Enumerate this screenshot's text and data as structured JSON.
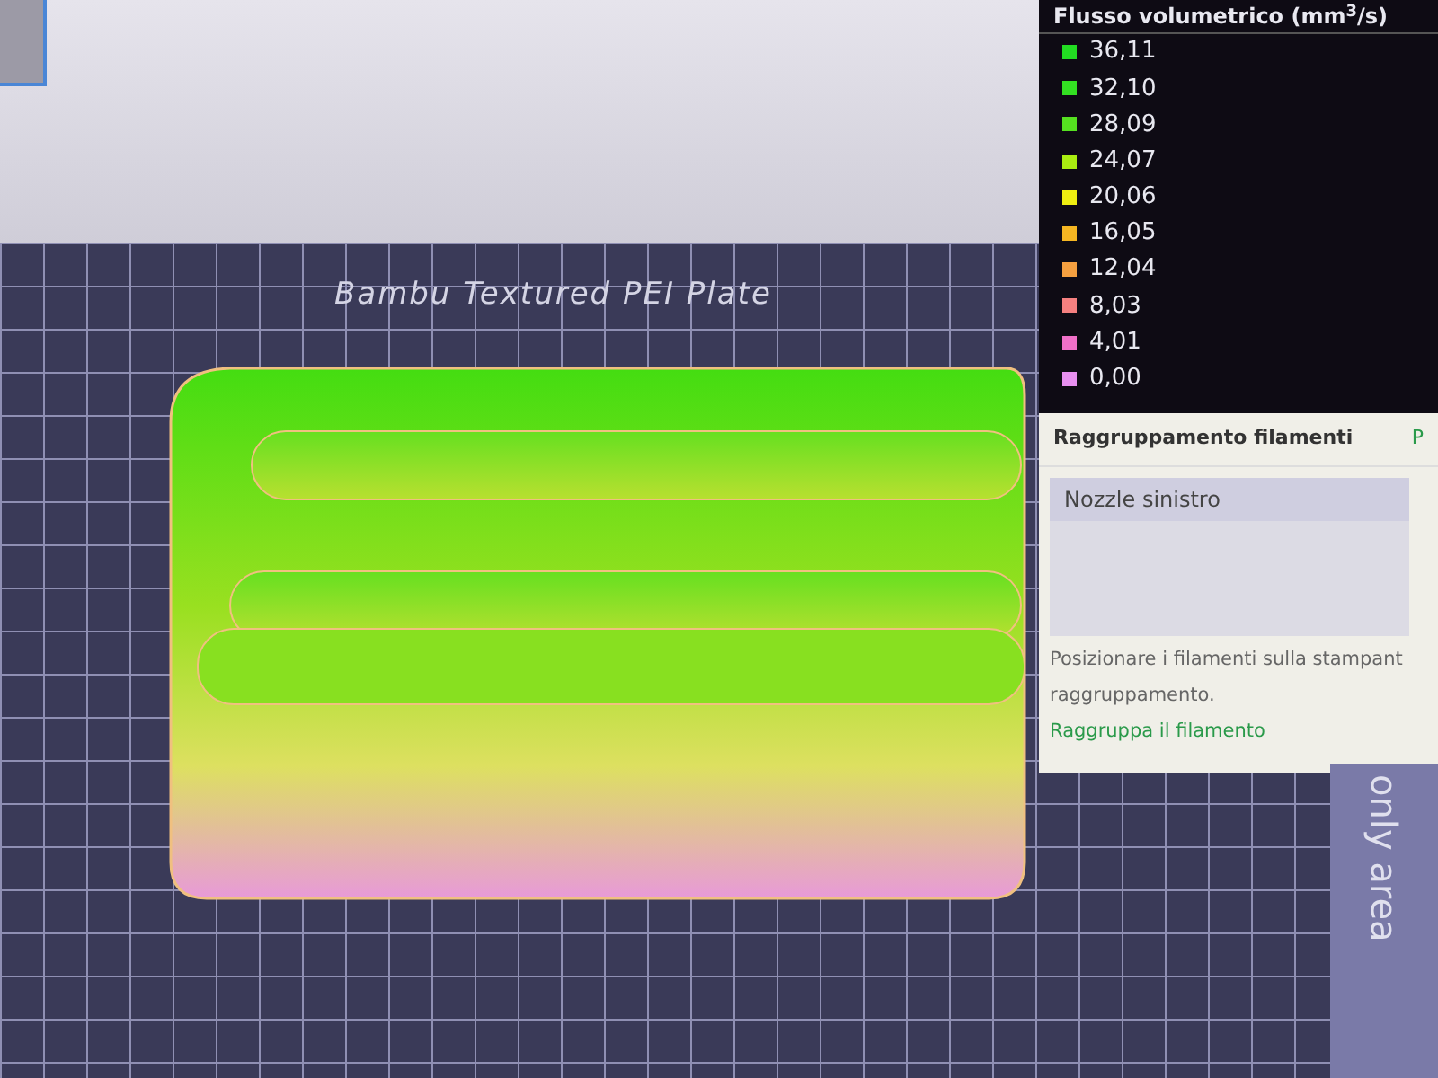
{
  "plate": {
    "label": "Bambu Textured PEI Plate"
  },
  "legend": {
    "title": "Flusso volumetrico (mm$^{3}$/s)",
    "items": [
      {
        "value": "36,11",
        "color": "#22dd22"
      },
      {
        "value": "32,10",
        "color": "#33e022"
      },
      {
        "value": "28,09",
        "color": "#55e020"
      },
      {
        "value": "24,07",
        "color": "#aaee11"
      },
      {
        "value": "20,06",
        "color": "#eeee11"
      },
      {
        "value": "16,05",
        "color": "#f5b622"
      },
      {
        "value": "12,04",
        "color": "#f5a040"
      },
      {
        "value": "8,03",
        "color": "#f58080"
      },
      {
        "value": "4,01",
        "color": "#f070c8"
      },
      {
        "value": "0,00",
        "color": "#e890f0"
      }
    ]
  },
  "filament_panel": {
    "title": "Raggruppamento filamenti",
    "title_right": "P",
    "nozzle": "Nozzle sinistro",
    "hint_lines": [
      "Posizionare i filamenti sulla stampant",
      "raggruppamento."
    ],
    "link": "Raggruppa il filamento"
  },
  "side_area": {
    "label": "only area"
  }
}
